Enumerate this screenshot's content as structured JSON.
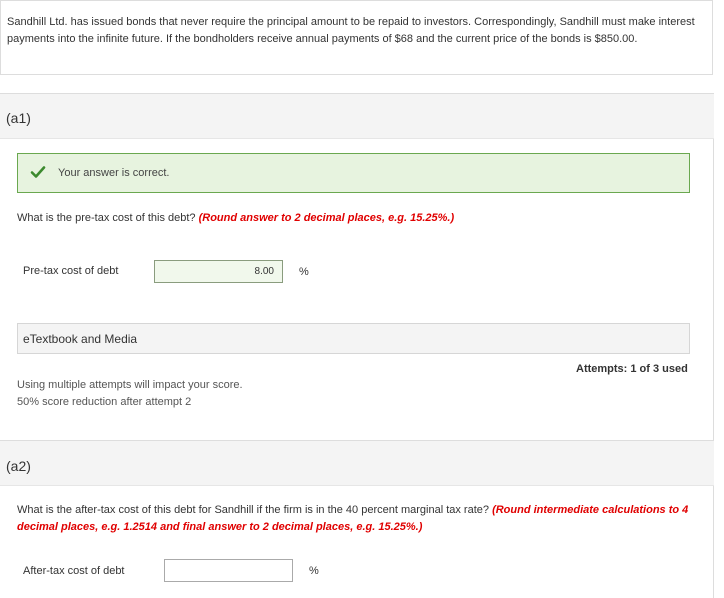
{
  "problem": {
    "text": "Sandhill Ltd. has issued bonds that never require the principal amount to be repaid to investors. Correspondingly, Sandhill must make interest payments into the infinite future. If the bondholders receive annual payments of $68 and the current price of the bonds is $850.00."
  },
  "part_a1": {
    "label": "(a1)",
    "feedback": "Your answer is correct.",
    "question": "What is the pre-tax cost of this debt?",
    "hint": "(Round answer to 2 decimal places, e.g. 15.25%.)",
    "field_label": "Pre-tax cost of debt",
    "value": "8.00",
    "unit": "%",
    "etextbook_label": "eTextbook and Media",
    "attempts": "Attempts: 1 of 3 used",
    "notice_line1": "Using multiple attempts will impact your score.",
    "notice_line2": "50% score reduction after attempt 2"
  },
  "part_a2": {
    "label": "(a2)",
    "question": "What is the after-tax cost of this debt for Sandhill if the firm is in the 40 percent marginal tax rate?",
    "hint": "(Round intermediate calculations to 4 decimal places, e.g. 1.2514 and final answer to 2 decimal places, e.g. 15.25%.)",
    "field_label": "After-tax cost of debt",
    "value": "",
    "unit": "%"
  },
  "colors": {
    "correct_bg": "#e7f3df",
    "correct_border": "#6aa84f",
    "check": "#3c8a2e",
    "hint_red": "#e00000"
  }
}
